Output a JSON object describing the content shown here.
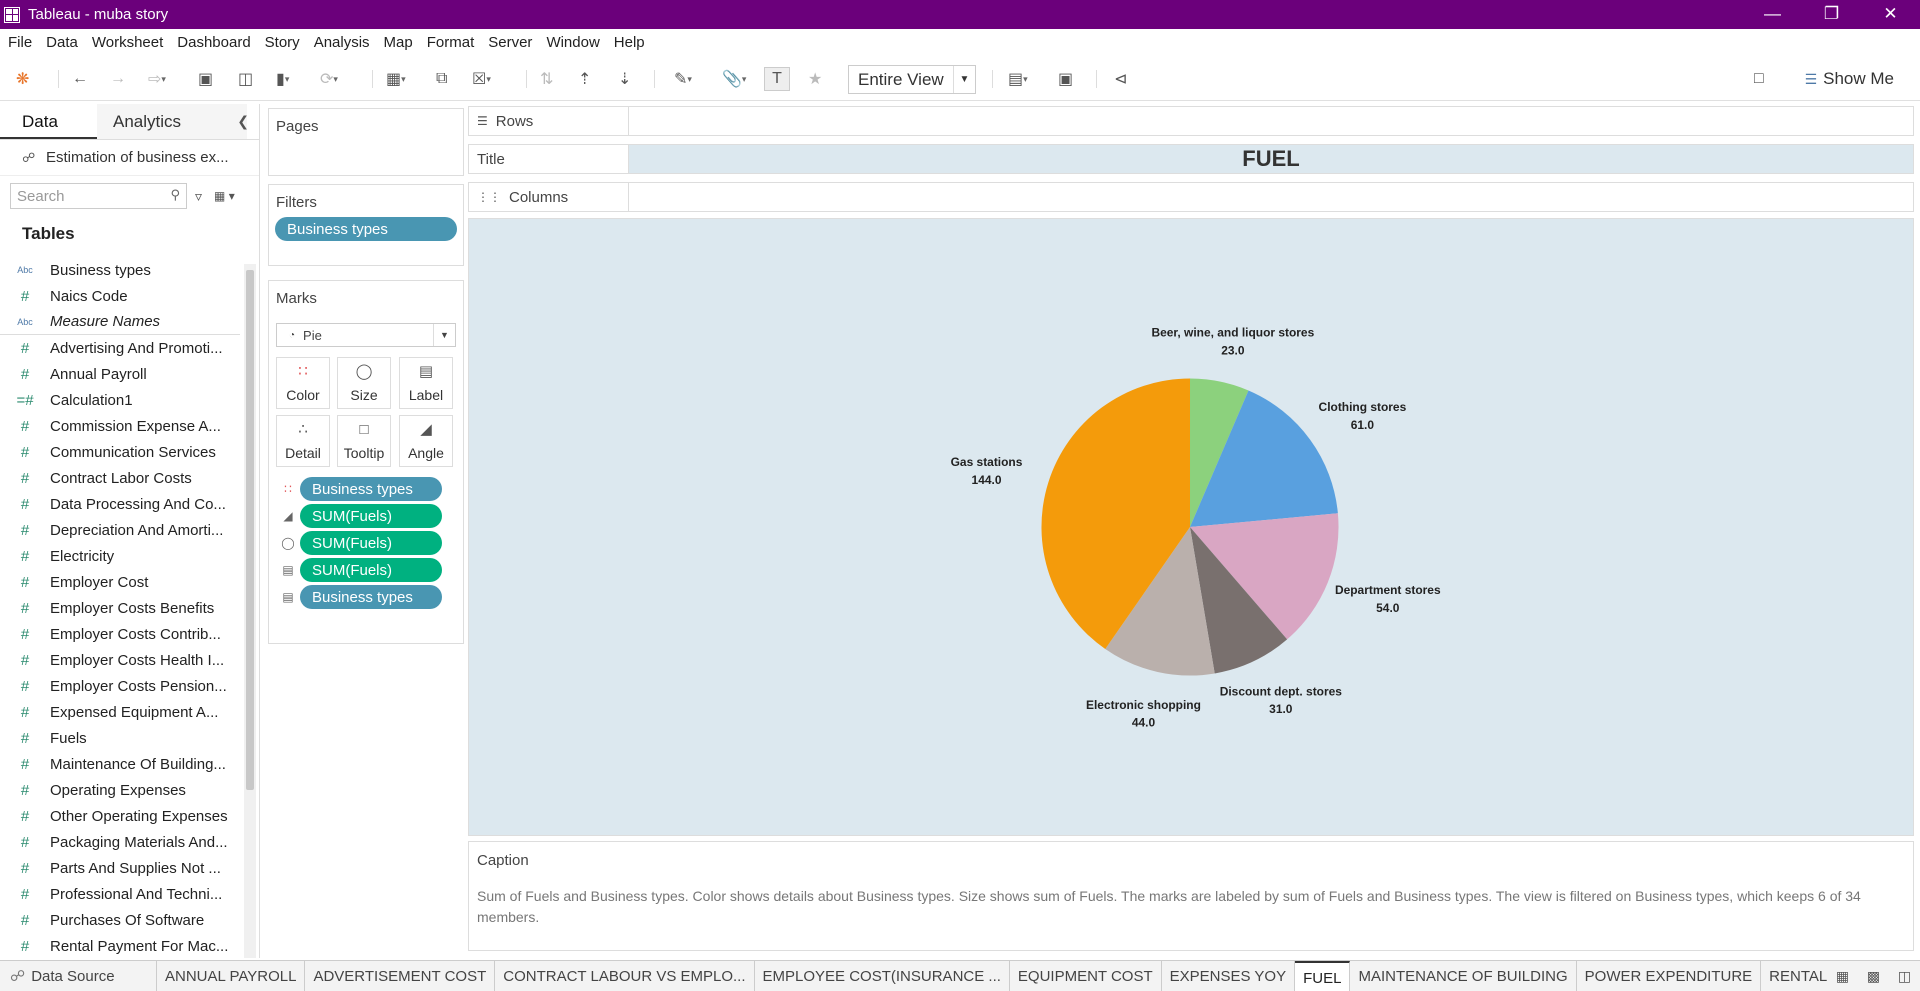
{
  "window": {
    "title": "Tableau - muba story"
  },
  "menu": [
    "File",
    "Data",
    "Worksheet",
    "Dashboard",
    "Story",
    "Analysis",
    "Map",
    "Format",
    "Server",
    "Window",
    "Help"
  ],
  "toolbar": {
    "view_mode": "Entire View",
    "show_me": "Show Me"
  },
  "datapane": {
    "tab_data": "Data",
    "tab_analytics": "Analytics",
    "datasource": "Estimation of business ex...",
    "search_placeholder": "Search",
    "tables_header": "Tables",
    "fields": [
      {
        "name": "Business types",
        "type": "Abc"
      },
      {
        "name": "Naics Code",
        "type": "#"
      },
      {
        "name": "Measure Names",
        "type": "Abc"
      },
      {
        "name": "Advertising And Promoti...",
        "type": "#"
      },
      {
        "name": "Annual Payroll",
        "type": "#"
      },
      {
        "name": "Calculation1",
        "type": "=#"
      },
      {
        "name": "Commission Expense A...",
        "type": "#"
      },
      {
        "name": "Communication Services",
        "type": "#"
      },
      {
        "name": "Contract Labor Costs",
        "type": "#"
      },
      {
        "name": "Data Processing And Co...",
        "type": "#"
      },
      {
        "name": "Depreciation And Amorti...",
        "type": "#"
      },
      {
        "name": "Electricity",
        "type": "#"
      },
      {
        "name": "Employer Cost",
        "type": "#"
      },
      {
        "name": "Employer Costs Benefits",
        "type": "#"
      },
      {
        "name": "Employer Costs Contrib...",
        "type": "#"
      },
      {
        "name": "Employer Costs Health I...",
        "type": "#"
      },
      {
        "name": "Employer Costs Pension...",
        "type": "#"
      },
      {
        "name": "Expensed Equipment A...",
        "type": "#"
      },
      {
        "name": "Fuels",
        "type": "#"
      },
      {
        "name": "Maintenance Of Building...",
        "type": "#"
      },
      {
        "name": "Operating Expenses",
        "type": "#"
      },
      {
        "name": "Other Operating Expenses",
        "type": "#"
      },
      {
        "name": "Packaging Materials And...",
        "type": "#"
      },
      {
        "name": "Parts And Supplies Not ...",
        "type": "#"
      },
      {
        "name": "Professional And Techni...",
        "type": "#"
      },
      {
        "name": "Purchases Of Software",
        "type": "#"
      },
      {
        "name": "Rental Payment For Mac...",
        "type": "#"
      }
    ]
  },
  "shelves": {
    "pages": "Pages",
    "filters": "Filters",
    "filter_pill": "Business types",
    "marks": "Marks",
    "mark_type": "Pie",
    "buttons": [
      "Color",
      "Size",
      "Label",
      "Detail",
      "Tooltip",
      "Angle"
    ],
    "mark_pills": [
      {
        "label": "Business types",
        "kind": "dim"
      },
      {
        "label": "SUM(Fuels)",
        "kind": "meas"
      },
      {
        "label": "SUM(Fuels)",
        "kind": "meas"
      },
      {
        "label": "SUM(Fuels)",
        "kind": "meas"
      },
      {
        "label": "Business types",
        "kind": "dim"
      }
    ],
    "rows": "Rows",
    "title": "Title",
    "columns": "Columns",
    "title_value": "FUEL"
  },
  "chart_data": {
    "type": "pie",
    "slices": [
      {
        "label": "Beer, wine, and liquor stores",
        "value": 23.0,
        "value_text": "23.0",
        "color": "#8cd17d"
      },
      {
        "label": "Clothing stores",
        "value": 61.0,
        "value_text": "61.0",
        "color": "#59a0df"
      },
      {
        "label": "Department stores",
        "value": 54.0,
        "value_text": "54.0",
        "color": "#d9a6c3"
      },
      {
        "label": "Discount dept. stores",
        "value": 31.0,
        "value_text": "31.0",
        "color": "#79706e"
      },
      {
        "label": "Electronic shopping",
        "value": 44.0,
        "value_text": "44.0",
        "color": "#bab0ac"
      },
      {
        "label": "Gas stations",
        "value": 144.0,
        "value_text": "144.0",
        "color": "#f49b0b"
      }
    ]
  },
  "caption": {
    "header": "Caption",
    "text": "Sum of Fuels and Business types.  Color shows details about Business types.  Size shows sum of Fuels.  The marks are labeled by sum of Fuels and Business types. The view is filtered on Business types, which keeps 6 of 34 members."
  },
  "bottom_tabs": {
    "datasource": "Data Source",
    "sheets": [
      "ANNUAL PAYROLL",
      "ADVERTISEMENT COST",
      "CONTRACT LABOUR VS EMPLO...",
      "EMPLOYEE COST(INSURANCE ...",
      "EQUIPMENT COST",
      "EXPENSES YOY",
      "FUEL",
      "MAINTENANCE OF BUILDING",
      "POWER EXPENDITURE",
      "RENTAL P..."
    ],
    "active": "FUEL"
  }
}
